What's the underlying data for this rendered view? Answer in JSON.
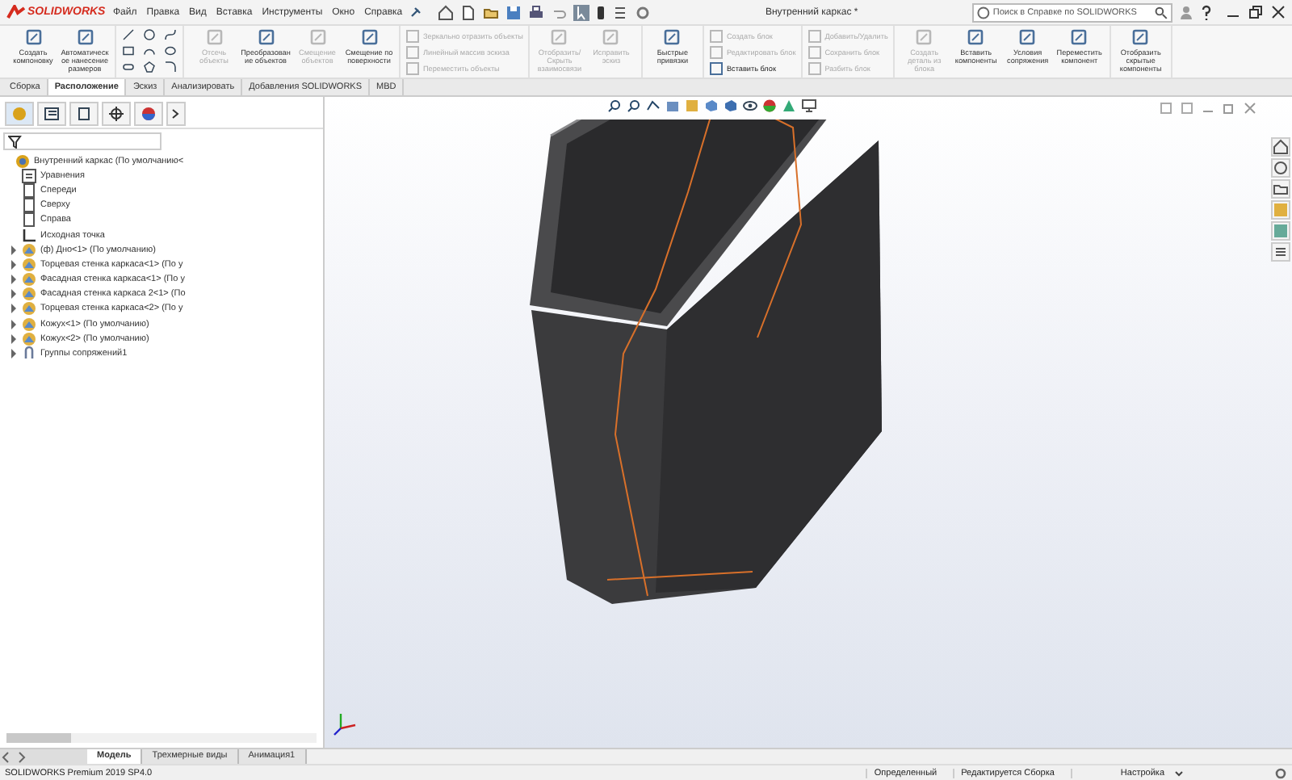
{
  "window": {
    "app": "SOLIDWORKS",
    "title": "Внутренний каркас *",
    "menu": [
      "Файл",
      "Правка",
      "Вид",
      "Вставка",
      "Инструменты",
      "Окно",
      "Справка"
    ],
    "search": {
      "placeholder": "Поиск в Справке по SOLIDWORKS"
    }
  },
  "ribbon": {
    "groups": [
      {
        "buttons": [
          {
            "label": "Создать компоновку",
            "disabled": false,
            "kind": "large"
          },
          {
            "label": "Автоматическое нанесение размеров",
            "disabled": false,
            "kind": "large"
          }
        ]
      },
      {
        "buttons": [
          {
            "label": "Отсечь объекты",
            "disabled": true,
            "kind": "large"
          },
          {
            "label": "Преобразование объектов",
            "disabled": false,
            "kind": "large"
          },
          {
            "label": "Смещение объектов",
            "disabled": true,
            "kind": "large"
          },
          {
            "label": "Смещение по поверхности",
            "disabled": false,
            "kind": "large"
          }
        ]
      },
      {
        "buttons": [
          {
            "label": "Зеркально отразить объекты",
            "disabled": true,
            "kind": "small"
          },
          {
            "label": "Линейный массив эскиза",
            "disabled": true,
            "kind": "small"
          },
          {
            "label": "Переместить объекты",
            "disabled": true,
            "kind": "small"
          }
        ]
      },
      {
        "buttons": [
          {
            "label": "Отобразить/Скрыть взаимосвязи",
            "disabled": true,
            "kind": "large"
          },
          {
            "label": "Исправить эскиз",
            "disabled": true,
            "kind": "large"
          }
        ]
      },
      {
        "buttons": [
          {
            "label": "Быстрые привязки",
            "disabled": false,
            "kind": "large"
          }
        ]
      },
      {
        "buttons": [
          {
            "label": "Создать блок",
            "disabled": true,
            "kind": "small"
          },
          {
            "label": "Редактировать блок",
            "disabled": true,
            "kind": "small"
          },
          {
            "label": "Вставить блок",
            "disabled": false,
            "kind": "small"
          }
        ]
      },
      {
        "buttons": [
          {
            "label": "Добавить/Удалить",
            "disabled": true,
            "kind": "small"
          },
          {
            "label": "Сохранить блок",
            "disabled": true,
            "kind": "small"
          },
          {
            "label": "Разбить блок",
            "disabled": true,
            "kind": "small"
          }
        ]
      },
      {
        "buttons": [
          {
            "label": "Создать деталь из блока",
            "disabled": true,
            "kind": "large"
          },
          {
            "label": "Вставить компоненты",
            "disabled": false,
            "kind": "large"
          },
          {
            "label": "Условия сопряжения",
            "disabled": false,
            "kind": "large"
          },
          {
            "label": "Переместить компонент",
            "disabled": false,
            "kind": "large"
          }
        ]
      },
      {
        "buttons": [
          {
            "label": "Отобразить скрытые компоненты",
            "disabled": false,
            "kind": "large"
          }
        ]
      }
    ]
  },
  "tabs": [
    {
      "label": "Сборка",
      "selected": false
    },
    {
      "label": "Расположение",
      "selected": true
    },
    {
      "label": "Эскиз",
      "selected": false
    },
    {
      "label": "Анализировать",
      "selected": false
    },
    {
      "label": "Добавления SOLIDWORKS",
      "selected": false
    },
    {
      "label": "MBD",
      "selected": false
    }
  ],
  "feature_tree": {
    "root": {
      "label": "Внутренний каркас  (По умолчанию<",
      "kind": "assembly",
      "children": [
        {
          "label": "Уравнения",
          "kind": "equations"
        },
        {
          "label": "Спереди",
          "kind": "plane"
        },
        {
          "label": "Сверху",
          "kind": "plane"
        },
        {
          "label": "Справа",
          "kind": "plane"
        },
        {
          "label": "Исходная точка",
          "kind": "origin"
        },
        {
          "label": "(ф) Дно<1> (По умолчанию)",
          "kind": "part",
          "expanded": false
        },
        {
          "label": "Торцевая стенка каркаса<1> (По у",
          "kind": "part",
          "expanded": false
        },
        {
          "label": "Фасадная стенка каркаса<1> (По у",
          "kind": "part",
          "expanded": false
        },
        {
          "label": "Фасадная стенка каркаса 2<1> (По",
          "kind": "part",
          "expanded": false
        },
        {
          "label": "Торцевая стенка каркаса<2> (По у",
          "kind": "part",
          "expanded": false
        },
        {
          "label": "Кожух<1> (По умолчанию)",
          "kind": "part",
          "expanded": false
        },
        {
          "label": "Кожух<2> (По умолчанию)",
          "kind": "part",
          "expanded": false
        },
        {
          "label": "Группы сопряжений1",
          "kind": "mates",
          "expanded": false
        }
      ]
    }
  },
  "bottom_tabs": [
    {
      "label": "Модель",
      "selected": true
    },
    {
      "label": "Трехмерные виды",
      "selected": false
    },
    {
      "label": "Анимация1",
      "selected": false
    }
  ],
  "status_bar": {
    "product": "SOLIDWORKS Premium 2019 SP4.0",
    "state": "Определенный",
    "mode": "Редактируется Сборка",
    "units": "Настройка"
  }
}
